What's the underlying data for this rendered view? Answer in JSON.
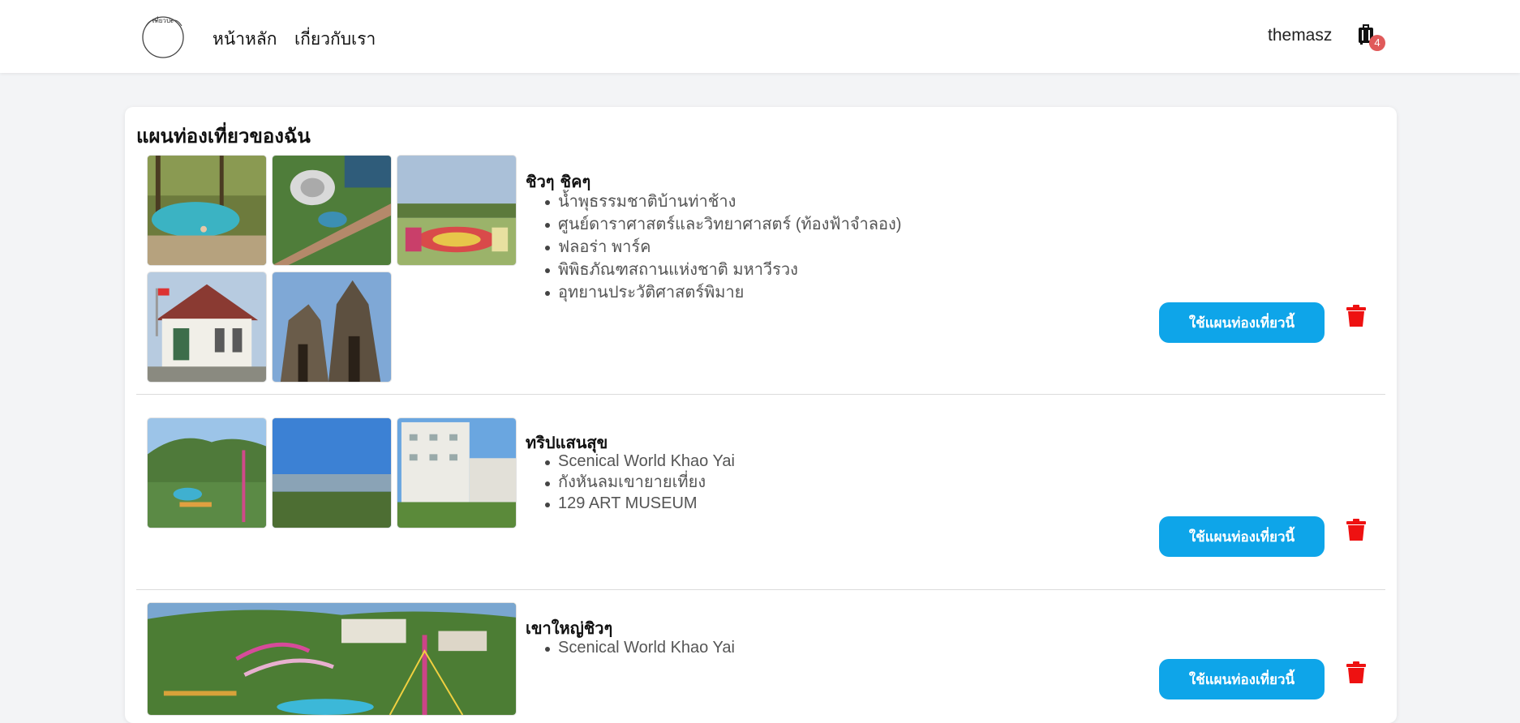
{
  "nav": {
    "logo_text": "เที่ยวปะ",
    "home": "หน้าหลัก",
    "about": "เกี่ยวกับเรา",
    "username": "themasz",
    "cart_count": "4",
    "badge_color": "#e05a5a"
  },
  "card": {
    "title": "แผนท่องเที่ยวของฉัน"
  },
  "plans": [
    {
      "name": "ชิวๆ ชิคๆ",
      "places": [
        "น้ำพุธรรมชาติบ้านท่าช้าง",
        "ศูนย์ดาราศาสตร์และวิทยาศาสตร์ (ท้องฟ้าจำลอง)",
        "ฟลอร่า พาร์ค",
        "พิพิธภัณฑสถานแห่งชาติ มหาวีรวง",
        "อุทยานประวัติศาสตร์พิมาย"
      ],
      "button": "ใช้แผนท่องเที่ยวนี้"
    },
    {
      "name": "ทริปแสนสุข",
      "places": [
        "Scenical World Khao Yai",
        "กังหันลมเขายายเที่ยง",
        "129 ART MUSEUM"
      ],
      "button": "ใช้แผนท่องเที่ยวนี้"
    },
    {
      "name": "เขาใหญ่ชิวๆ",
      "places": [
        "Scenical World Khao Yai"
      ],
      "button": "ใช้แผนท่องเที่ยวนี้"
    }
  ],
  "colors": {
    "accent": "#0ea5e9",
    "danger": "#ee1111",
    "background": "#f3f4f6"
  }
}
